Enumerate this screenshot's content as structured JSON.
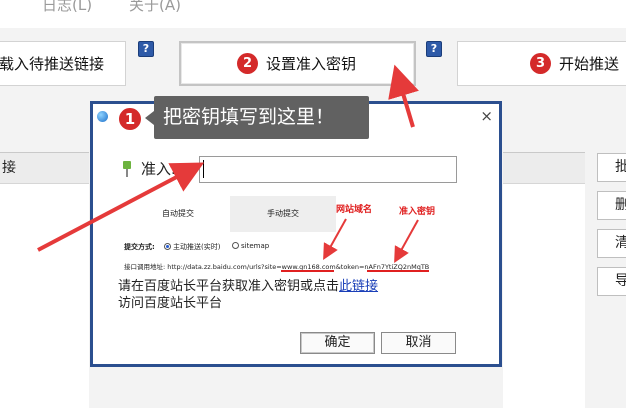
{
  "menu": [
    "日志(L)",
    "关于(A)"
  ],
  "steps": [
    {
      "num": "",
      "label": "载入待推送链接"
    },
    {
      "num": "2",
      "label": "设置准入密钥"
    },
    {
      "num": "3",
      "label": "开始推送"
    }
  ],
  "help_glyph": "?",
  "left_list": {
    "header": "接"
  },
  "side_buttons": [
    "批",
    "删",
    "清",
    "导"
  ],
  "dialog": {
    "close_glyph": "×",
    "callout_num": "1",
    "callout_text": "把密钥填写到这里！",
    "field_label": "准入...",
    "input_value": "",
    "guide": {
      "tab_auto": "自动提交",
      "tab_manual": "手动提交",
      "label_domain": "网站域名",
      "label_key": "准入密钥",
      "submit_mode_label": "提交方式:",
      "option_realtime": "主动推送(实时)",
      "option_sitemap": "sitemap",
      "api_line": "接口调用地址: http://data.zz.baidu.com/urls?site=www.gn168.com&token=nAFn7YtiZQ2nMqTB"
    },
    "body_line1_pre": "请在百度站长平台获取准入密钥或点击",
    "body_link": "此链接",
    "body_line2": "访问百度站长平台",
    "ok_label": "确定",
    "cancel_label": "取消"
  },
  "colors": {
    "accent_red": "#d42a2a",
    "dialog_border": "#2b4f8f",
    "callout_bg": "#616161",
    "link": "#1a3fb8"
  }
}
